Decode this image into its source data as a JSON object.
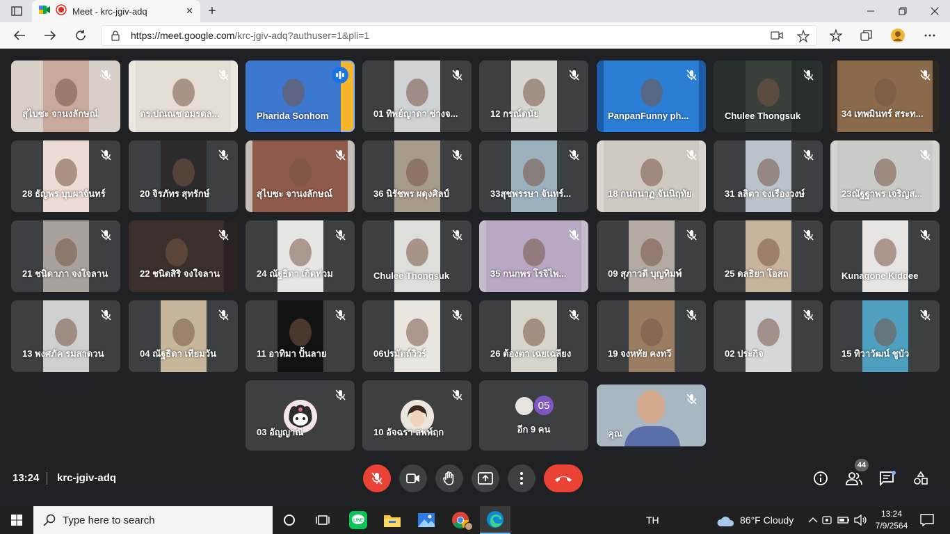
{
  "browser": {
    "tab_title": "Meet - krc-jgiv-adq",
    "url_host": "https://meet.google.com",
    "url_path": "/krc-jgiv-adq?authuser=1&pli=1",
    "close_glyph": "✕",
    "new_tab_glyph": "+"
  },
  "tiles": [
    {
      "name": "สุไบซะ จานงลักษณ์",
      "bg": "#d8cfc8",
      "vid": "#c9a99b",
      "muted": true
    },
    {
      "name": "ดร.ปณณช อมรดล...",
      "bg": "#ebe8e2",
      "vid": "#e4ddd3",
      "muted": true
    },
    {
      "name": "Pharida Sonhom",
      "bg": "#f5b52a",
      "vid": "#3c78d0",
      "muted": false,
      "speaking": true
    },
    {
      "name": "01 ทิพย์ญาดา ช่างจ...",
      "bg": "#3c4043",
      "vid": "#cfd3d6",
      "muted": true
    },
    {
      "name": "12 กรณ์ดนัย",
      "bg": "#3c4043",
      "vid": "#d7d7d2",
      "muted": true
    },
    {
      "name": "PanpanFunny ph...",
      "bg": "#1d5da8",
      "vid": "#2a7fd4",
      "muted": true
    },
    {
      "name": "Chulee Thongsuk",
      "bg": "#27302c",
      "vid": "#37413a",
      "muted": true
    },
    {
      "name": "34 เทพมินทร์ สระท...",
      "bg": "#2d2620",
      "vid": "#8a6a4a",
      "muted": true
    },
    {
      "name": "28 ธัญพร บุบผาจันทร์",
      "bg": "#3c4043",
      "vid": "#ecdcd3",
      "muted": true
    },
    {
      "name": "20 จิรภัทร สุทรักษ์",
      "bg": "#3c4043",
      "vid": "#2c2a2a",
      "muted": true
    },
    {
      "name": "สุไบซะ จานงลักษณ์",
      "bg": "#c6bdb6",
      "vid": "#8e5a4a",
      "muted": true
    },
    {
      "name": "36 นิรัชพร ผดุงศิลป์",
      "bg": "#3c4043",
      "vid": "#a79a88",
      "muted": true
    },
    {
      "name": "33สุชพรรษา จันทร์...",
      "bg": "#3c4043",
      "vid": "#9bb0bd",
      "muted": true
    },
    {
      "name": "18 กนกนาฏ จันนิฤทัย",
      "bg": "#d9d6d1",
      "vid": "#cfc9c2",
      "muted": true
    },
    {
      "name": "31 ลลิตา จงเรืองวงษ์",
      "bg": "#3c4043",
      "vid": "#b9c3c9",
      "muted": true
    },
    {
      "name": "23ณัฐฐาพร เจริญส...",
      "bg": "#d1d3d0",
      "vid": "#c9cbc7",
      "muted": true
    },
    {
      "name": "21 ชนิดาภา จงใจลาน",
      "bg": "#3c4043",
      "vid": "#a9a19b",
      "muted": true
    },
    {
      "name": "22 ชนิดสิริ จงใจลาน",
      "bg": "#2a2220",
      "vid": "#3a2f2b",
      "muted": true
    },
    {
      "name": "24 ณัฐธิดา เกิดท่วม",
      "bg": "#3c4043",
      "vid": "#e6e7e5",
      "muted": true
    },
    {
      "name": "Chulee Thongsuk",
      "bg": "#3c4043",
      "vid": "#dedfda",
      "muted": true
    },
    {
      "name": "35 กนกพร โรจิไพ...",
      "bg": "#c5bcc9",
      "vid": "#b9a8c3",
      "muted": true
    },
    {
      "name": "09 สุภาวดี บุญทิมพ์",
      "bg": "#3c4043",
      "vid": "#b3aba2",
      "muted": true
    },
    {
      "name": "25 ดลธิยา โอสถ",
      "bg": "#3c4043",
      "vid": "#c8b39d",
      "muted": true
    },
    {
      "name": "Kunagone Kiddee",
      "bg": "#3c4043",
      "vid": "#e7e5e3",
      "muted": true
    },
    {
      "name": "13 พงศภัค รมสาดวน",
      "bg": "#3c4043",
      "vid": "#cfcfcf",
      "muted": true
    },
    {
      "name": "04 ณัฐธิดา เทียมวัน",
      "bg": "#3c4043",
      "vid": "#c7b79a",
      "muted": true
    },
    {
      "name": "11 อาทิมา ปั้นลาย",
      "bg": "#3c4043",
      "vid": "#121212",
      "muted": true
    },
    {
      "name": "06ปรมัตถ์วิวร์",
      "bg": "#3c4043",
      "vid": "#e9e6e0",
      "muted": true
    },
    {
      "name": "26 ต้องตา เฉยเฉลียง",
      "bg": "#3c4043",
      "vid": "#d6d4cb",
      "muted": true
    },
    {
      "name": "19 จงหทัย คงทวี",
      "bg": "#3c4043",
      "vid": "#9b7e62",
      "muted": true
    },
    {
      "name": "02 ประกิจ",
      "bg": "#3c4043",
      "vid": "#d4d8db",
      "muted": true
    },
    {
      "name": "15 ทิวาวัฒน์ ชูบัว",
      "bg": "#3c4043",
      "vid": "#4fa0c0",
      "muted": true
    }
  ],
  "bottom_tiles": [
    {
      "name": "03 อัญญาณี",
      "muted": true
    },
    {
      "name": "10 อัจฉรา ลพพ์ฤก",
      "muted": true
    },
    {
      "name": "อีก 9 คน",
      "badge": "05"
    },
    {
      "name": "คุณ",
      "muted": true
    }
  ],
  "footer": {
    "time": "13:24",
    "meeting_code": "krc-jgiv-adq",
    "people_count": "44"
  },
  "taskbar": {
    "search_placeholder": "Type here to search",
    "lang": "TH",
    "weather": "86°F  Cloudy",
    "clock_time": "13:24",
    "clock_date": "7/9/2564"
  },
  "colors": {
    "end_call": "#ea4335",
    "mic_off": "#ea4335",
    "accent": "#8ab4f8"
  }
}
